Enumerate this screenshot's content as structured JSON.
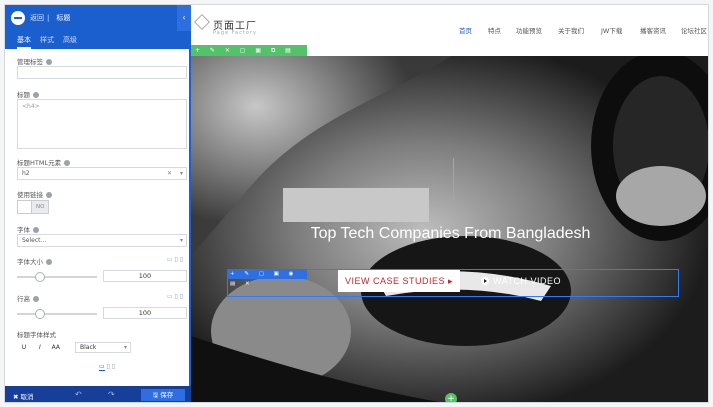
{
  "panel": {
    "breadcrumb_back": "返回",
    "breadcrumb_current": "标题",
    "tabs": [
      "基本",
      "样式",
      "高级"
    ],
    "fields": {
      "admin_label": "管理标签",
      "title_label": "标题",
      "title_placeholder": "<h4>",
      "html_tag_label": "标题HTML元素",
      "html_tag_value": "h2",
      "link_label": "使用链接",
      "link_toggle_text": "NO",
      "font_label": "字体",
      "font_placeholder": "Select...",
      "font_size_label": "字体大小",
      "font_size_value": "100",
      "line_height_label": "行高",
      "line_height_value": "100",
      "heading_style_label": "标题字体样式",
      "typo_buttons": [
        "U",
        "I",
        "AA"
      ],
      "color_value": "Black"
    },
    "footer": {
      "cancel": "✖ 取消",
      "save": "🖫 保存"
    }
  },
  "site": {
    "logo_text": "页面工厂",
    "logo_sub": "Page Factory",
    "nav": [
      "首页",
      "特点",
      "功能预览",
      "关于我们",
      "JW下载",
      "播客资讯",
      "论坛社区"
    ],
    "hero_title": "Top Tech Companies From Bangladesh",
    "cta_primary": "VIEW CASE STUDIES ▸",
    "cta_secondary": "WATCH VIDEO"
  },
  "colors": {
    "primary": "#1b5fcf",
    "green": "#54c26a",
    "cta_text": "#c0282d"
  }
}
